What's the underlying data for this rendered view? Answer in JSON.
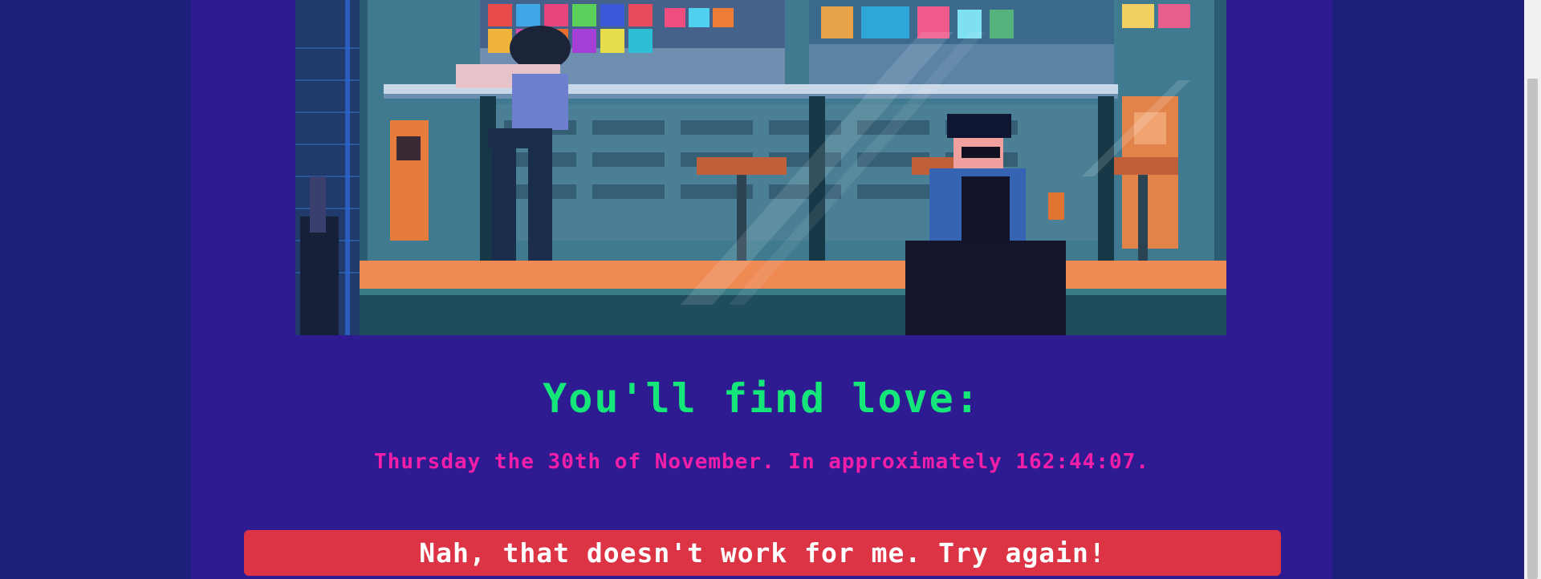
{
  "result": {
    "headline": "You'll find love:",
    "detail": "Thursday the 30th of November. In approximately 162:44:07.",
    "retry_label": "Nah, that doesn't work for me. Try again!"
  },
  "colors": {
    "page_background": "#1e1f7a",
    "content_background": "#2e1b92",
    "headline": "#15e67a",
    "detail": "#f41ea8",
    "retry_button": "#dc3444"
  },
  "illustration": "pixel-art-night-cafe-scene"
}
